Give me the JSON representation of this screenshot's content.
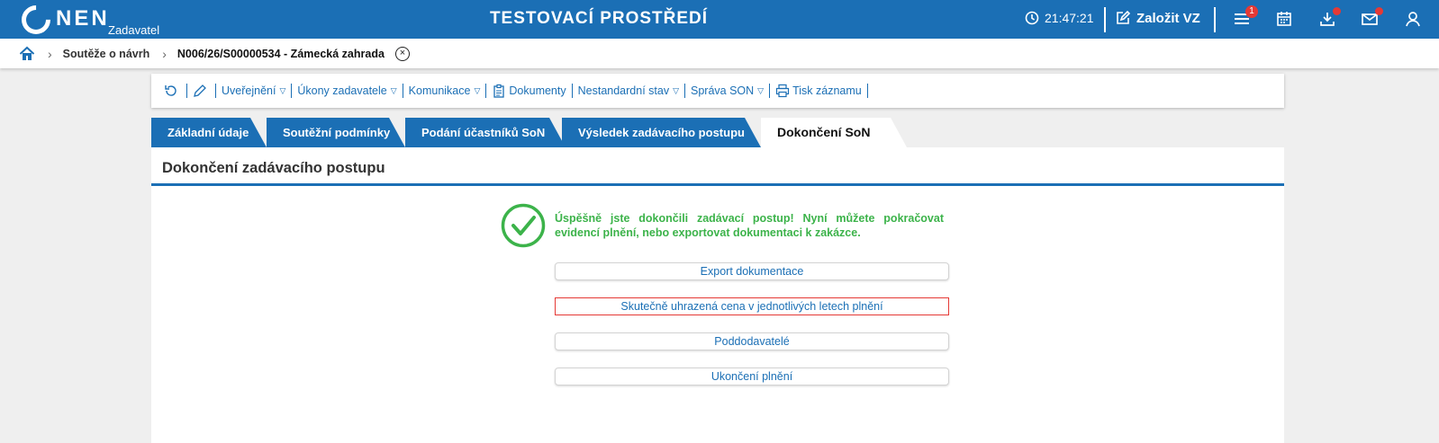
{
  "header": {
    "logo_text": "NEN",
    "logo_sub": "Zadavatel",
    "env_title": "TESTOVACÍ PROSTŘEDÍ",
    "time": "21:47:21",
    "create_label": "Založit VZ",
    "menu_badge": "1",
    "icons": [
      "clock-icon",
      "edit-icon",
      "menu-icon",
      "calendar-icon",
      "download-icon",
      "mail-icon",
      "user-icon"
    ]
  },
  "breadcrumb": {
    "items": [
      "Soutěže o návrh",
      "N006/26/S00000534 - Zámecká zahrada"
    ],
    "close_symbol": "×"
  },
  "toolbar": {
    "items": [
      {
        "label": "Uveřejnění",
        "dropdown": true
      },
      {
        "label": "Úkony zadavatele",
        "dropdown": true
      },
      {
        "label": "Komunikace",
        "dropdown": true
      },
      {
        "label": "Dokumenty",
        "dropdown": false
      },
      {
        "label": "Nestandardní stav",
        "dropdown": true
      },
      {
        "label": "Správa SON",
        "dropdown": true
      },
      {
        "label": "Tisk záznamu",
        "dropdown": false
      }
    ],
    "caret": "▽"
  },
  "tabs": [
    {
      "label": "Základní údaje"
    },
    {
      "label": "Soutěžní podmínky"
    },
    {
      "label": "Podání účastníků SoN"
    },
    {
      "label": "Výsledek zadávacího postupu"
    },
    {
      "label": "Dokončení SoN",
      "active": true
    }
  ],
  "main": {
    "title": "Dokončení zadávacího postupu",
    "success_message": "Úspěšně jste dokončili zadávací postup! Nyní můžete pokračovat evidencí plnění, nebo exportovat dokumentaci k zakázce.",
    "buttons": [
      "Export dokumentace",
      "Skutečně uhrazená cena v jednotlivých letech plnění",
      "Poddodavatelé",
      "Ukončení plnění"
    ]
  },
  "colors": {
    "brand": "#1b6fb5",
    "success": "#3cb34a",
    "badge": "#e53935"
  }
}
